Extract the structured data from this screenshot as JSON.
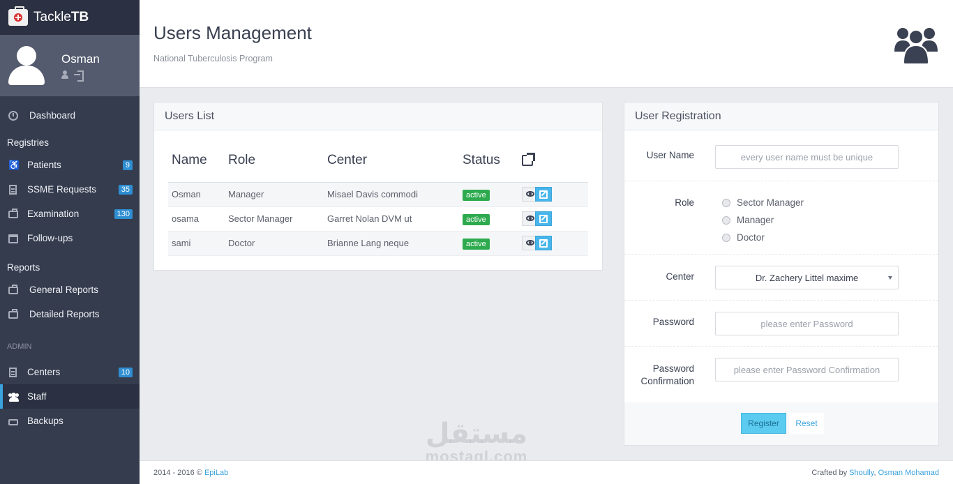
{
  "brand": {
    "name_light": "Tackle",
    "name_bold": "TB"
  },
  "user": {
    "name": "Osman"
  },
  "nav": {
    "dashboard": "Dashboard",
    "registries_title": "Registries",
    "patients": {
      "label": "Patients",
      "badge": "9"
    },
    "ssme": {
      "label": "SSME Requests",
      "badge": "35"
    },
    "examination": {
      "label": "Examination",
      "badge": "130"
    },
    "followups": "Follow-ups",
    "reports_title": "Reports",
    "general_reports": "General Reports",
    "detailed_reports": "Detailed Reports",
    "admin_title": "ADMIN",
    "centers": {
      "label": "Centers",
      "badge": "10"
    },
    "staff": "Staff",
    "backups": "Backups"
  },
  "header": {
    "title": "Users Management",
    "subtitle": "National Tuberculosis Program"
  },
  "users_list": {
    "title": "Users List",
    "columns": [
      "Name",
      "Role",
      "Center",
      "Status"
    ],
    "rows": [
      {
        "name": "Osman",
        "role": "Manager",
        "center": "Misael Davis commodi",
        "status": "active"
      },
      {
        "name": "osama",
        "role": "Sector Manager",
        "center": "Garret Nolan DVM ut",
        "status": "active"
      },
      {
        "name": "sami",
        "role": "Doctor",
        "center": "Brianne Lang neque",
        "status": "active"
      }
    ]
  },
  "registration": {
    "title": "User Registration",
    "username_label": "User Name",
    "username_placeholder": "every user name must be unique",
    "role_label": "Role",
    "roles": [
      "Sector Manager",
      "Manager",
      "Doctor"
    ],
    "center_label": "Center",
    "center_selected": "Dr. Zachery Littel maxime",
    "password_label": "Password",
    "password_placeholder": "please enter Password",
    "confirm_label": "Password Confirmation",
    "confirm_placeholder": "please enter Password Confirmation",
    "register_btn": "Register",
    "reset_btn": "Reset"
  },
  "footer": {
    "left_text": "2014 - 2016 © ",
    "left_link": "EpiLab",
    "right_text": "Crafted by ",
    "right_link1": "Shoully",
    "right_sep": ", ",
    "right_link2": "Osman Mohamad"
  },
  "watermark": {
    "arabic": "مستقل",
    "latin": "mostaql.com"
  },
  "colors": {
    "sidebar": "#353c4e",
    "accent": "#3aa2dd",
    "status_active": "#2daa4e"
  }
}
